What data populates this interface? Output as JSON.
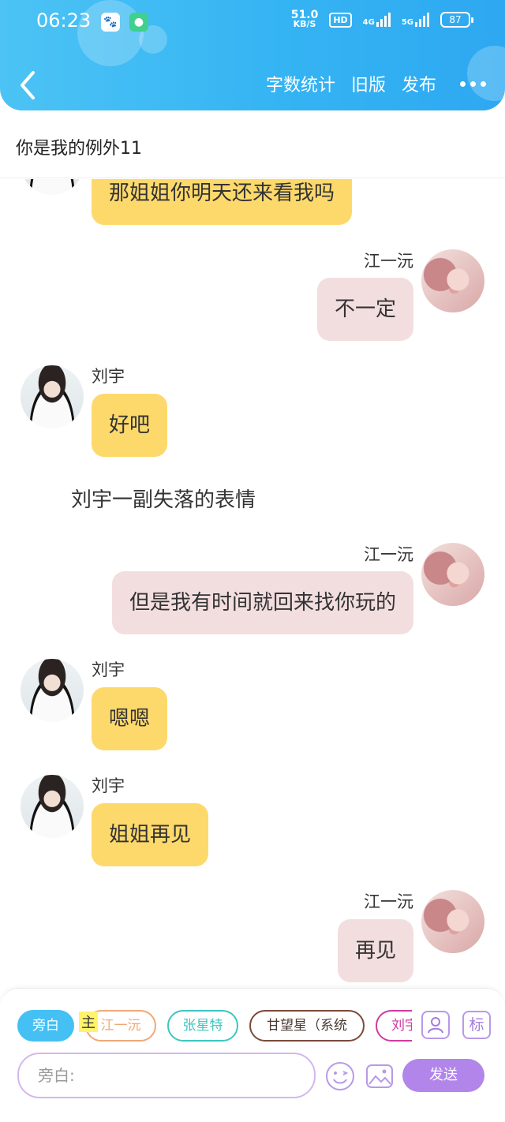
{
  "status_bar": {
    "time": "06:23",
    "net_speed_value": "51.0",
    "net_speed_unit": "KB/S",
    "hd": "HD",
    "signal_1": "4G",
    "signal_2": "5G",
    "battery": "87"
  },
  "nav": {
    "word_count": "字数统计",
    "old_version": "旧版",
    "publish": "发布"
  },
  "story_title": "你是我的例外11",
  "messages": [
    {
      "speaker": "",
      "text": "那姐姐你明天还来看我吗",
      "side": "left"
    },
    {
      "speaker": "江一沅",
      "text": "不一定",
      "side": "right"
    },
    {
      "speaker": "刘宇",
      "text": "好吧",
      "side": "left"
    },
    {
      "speaker": "",
      "text": "刘宇一副失落的表情",
      "side": "narration"
    },
    {
      "speaker": "江一沅",
      "text": "但是我有时间就回来找你玩的",
      "side": "right"
    },
    {
      "speaker": "刘宇",
      "text": "嗯嗯",
      "side": "left"
    },
    {
      "speaker": "刘宇",
      "text": "姐姐再见",
      "side": "left"
    },
    {
      "speaker": "江一沅",
      "text": "再见",
      "side": "right"
    }
  ],
  "roles": [
    {
      "label": "旁白",
      "color": "#45c0f5"
    },
    {
      "label": "江一沅",
      "color": "#f0a878"
    },
    {
      "label": "张星特",
      "color": "#3dc6c0"
    },
    {
      "label": "甘望星（系统",
      "color": "#7a4a3a"
    },
    {
      "label": "刘宇",
      "color": "#d03aa0"
    }
  ],
  "main_tag": "主",
  "side_icons": {
    "label_icon_text": "标"
  },
  "composer": {
    "placeholder": "旁白:",
    "send": "发送"
  },
  "colors": {
    "header": "#35b4f3",
    "left_bubble": "#fdd96b",
    "right_bubble": "#f3dedf",
    "send_button": "#b285ea"
  }
}
